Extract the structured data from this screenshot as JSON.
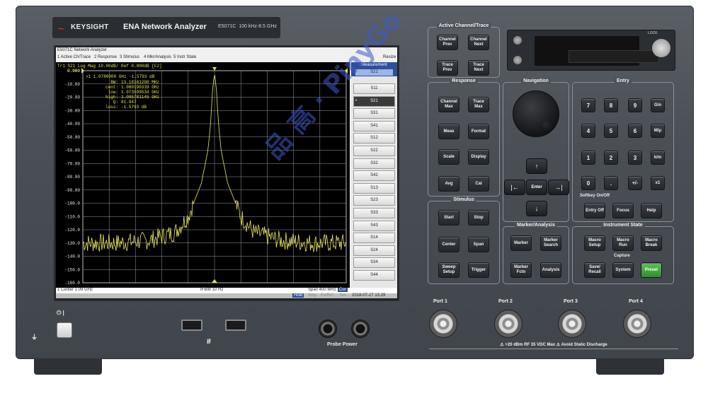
{
  "brand": {
    "name": "KEYSIGHT",
    "model": "ENA Network Analyzer",
    "model_no": "E5071C",
    "range": "100 kHz-8.5 GHz"
  },
  "screen": {
    "window_title": "E5071C Network Analyzer",
    "menu": [
      "1 Active Ch/Trace",
      "2 Response",
      "3 Stimulus",
      "4 Mkr/Analysis",
      "5 Instr State",
      "Resize"
    ],
    "trace_header": "Tr1  S21  Log Mag 10.00dB/ Ref 0.000dB [F2]",
    "top_value": "0.000",
    "marker_line": ">1  1.0780000 GHz  -1.5793 dB",
    "marker_stats": [
      {
        "k": "BW:",
        "v": "13.18161200 MHz"
      },
      {
        "k": "cent:",
        "v": "1.080190339 GHz"
      },
      {
        "k": "low:",
        "v": "1.073599534 GHz"
      },
      {
        "k": "high:",
        "v": "1.086781145 GHz"
      },
      {
        "k": "Q:",
        "v": "81.947"
      },
      {
        "k": "loss:",
        "v": "-1.5793 dB"
      }
    ],
    "y_ticks": [
      "0.000",
      "-10.00",
      "-20.00",
      "-30.00",
      "-40.00",
      "-50.00",
      "-60.00",
      "-70.00",
      "-80.00",
      "-90.00",
      "-100.0",
      "-110.0",
      "-120.0",
      "-130.0",
      "-140.0",
      "-150.0",
      "-160.0"
    ],
    "status": {
      "left": "1  Center 1.09 GHz",
      "mid": "IFBW 10 Hz",
      "right": "Span 400 MHz",
      "cor": "Cor"
    },
    "bottom": {
      "hold": "Hold",
      "stop": "Stop",
      "extref": "ExtRef",
      "svc": "Svc",
      "datetime": "2018-07-27 15:29"
    }
  },
  "measurement_panel": {
    "title": "Measurement",
    "current": "S21",
    "buttons": [
      "S11",
      "S21",
      "S31",
      "S41",
      "S12",
      "S22",
      "S32",
      "S42",
      "S13",
      "S23",
      "S33",
      "S43",
      "S14",
      "S24",
      "S34",
      "S44"
    ],
    "selected": "S21"
  },
  "groups": {
    "active": "Active Channel/Trace",
    "response": "Response",
    "navigation": "Navigation",
    "entry": "Entry",
    "stimulus": "Stimulus",
    "marker": "Marker/Analysis",
    "instr": "Instrument State"
  },
  "keys": {
    "channel_prev": "Channel Prev",
    "channel_next": "Channel Next",
    "trace_prev": "Trace Prev",
    "trace_next": "Trace Next",
    "channel_max": "Channel Max",
    "trace_max": "Trace Max",
    "meas": "Meas",
    "format": "Format",
    "scale": "Scale",
    "display": "Display",
    "avg": "Avg",
    "cal": "Cal",
    "start": "Start",
    "stop": "Stop",
    "center": "Center",
    "span": "Span",
    "sweep_setup": "Sweep Setup",
    "trigger": "Trigger",
    "marker": "Marker",
    "marker_search": "Marker Search",
    "marker_fctn": "Marker Fctn",
    "analysis": "Analysis",
    "macro_setup": "Macro Setup",
    "macro_run": "Macro Run",
    "macro_break": "Macro Break",
    "save_recall": "Save/ Recall",
    "system": "System",
    "preset": "Preset",
    "k7": "7",
    "k8": "8",
    "k9": "9",
    "kg": "G/n",
    "k4": "4",
    "k5": "5",
    "k6": "6",
    "km": "M/μ",
    "k1": "1",
    "k2": "2",
    "k3": "3",
    "kk": "k/m",
    "k0": "0",
    "kdot": ".",
    "kpm": "+/-",
    "kx1": "x1",
    "softkey_label": "Softkey On/Off",
    "entry_off": "Entry Off",
    "focus": "Focus",
    "help": "Help",
    "capture": "Capture",
    "enter": "Enter",
    "up": "↑",
    "down": "↓",
    "left": "|←",
    "right": "→|"
  },
  "front": {
    "lock": "LOCK",
    "ports": [
      "Port 1",
      "Port 2",
      "Port 3",
      "Port 4"
    ],
    "warning": "⚠ +20 dBm RF  35 VDC Max       ⚠ Avoid Static Discharge",
    "probe_power": "Probe Power",
    "usb_symbol": "⭠⯇",
    "power_symbol": "⏻ |"
  },
  "watermark": "品 高 · PinyGo",
  "chart_data": {
    "type": "line",
    "series": [],
    "x": [
      -200,
      -150,
      -100,
      -60,
      -40,
      -20,
      -10,
      -6,
      -3,
      0,
      3,
      6,
      10,
      20,
      40,
      60,
      100,
      150,
      200
    ],
    "values": [
      -130,
      -130,
      -128,
      -122,
      -110,
      -85,
      -60,
      -40,
      -15,
      -1.58,
      -15,
      -40,
      -60,
      -85,
      -110,
      -122,
      -128,
      -130,
      -130
    ],
    "xlabel": "",
    "ylabel": "",
    "ylim": [
      -160,
      0
    ],
    "grid": true,
    "center_ghz": 1.09,
    "span_mhz": 400
  }
}
